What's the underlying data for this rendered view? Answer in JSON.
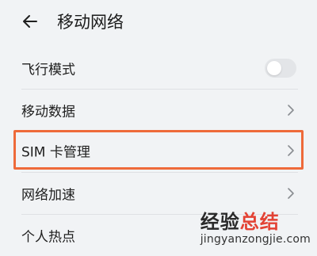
{
  "header": {
    "title": "移动网络"
  },
  "rows": [
    {
      "label": "飞行模式",
      "control": "toggle",
      "toggle_on": false
    },
    {
      "label": "移动数据",
      "control": "chevron"
    },
    {
      "label": "SIM 卡管理",
      "control": "chevron",
      "highlighted": true,
      "highlight_color": "#ee6a3a"
    },
    {
      "label": "网络加速",
      "control": "chevron"
    },
    {
      "label": "个人热点",
      "control": "none"
    }
  ],
  "watermark": {
    "text_part1": "经验",
    "text_part2": "总结",
    "url": "jingyanzongjie.com"
  },
  "colors": {
    "background": "#f1f3f5",
    "accent_highlight": "#ee6a3a",
    "watermark_red": "#e34234"
  },
  "icons": {
    "back": "arrow-left-icon",
    "chevron": "chevron-right-icon"
  }
}
